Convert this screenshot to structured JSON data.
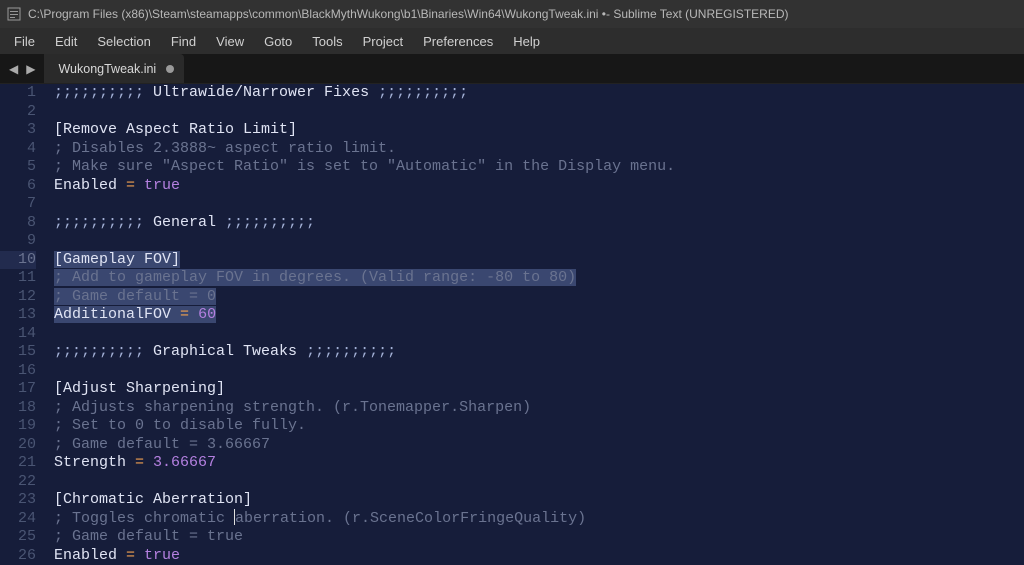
{
  "titlebar": {
    "path": "C:\\Program Files (x86)\\Steam\\steamapps\\common\\BlackMythWukong\\b1\\Binaries\\Win64\\WukongTweak.ini •",
    "app_suffix": " - Sublime Text (UNREGISTERED)"
  },
  "menus": [
    "File",
    "Edit",
    "Selection",
    "Find",
    "View",
    "Goto",
    "Tools",
    "Project",
    "Preferences",
    "Help"
  ],
  "tab": {
    "label": "WukongTweak.ini",
    "dirty": true
  },
  "lines": [
    {
      "n": 1,
      "seg": [
        {
          "c": "tok-punc",
          "t": ";;;;;;;;;; "
        },
        {
          "c": "tok-text",
          "t": "Ultrawide/Narrower Fixes "
        },
        {
          "c": "tok-punc",
          "t": ";;;;;;;;;;"
        }
      ]
    },
    {
      "n": 2,
      "seg": []
    },
    {
      "n": 3,
      "seg": [
        {
          "c": "tok-section",
          "t": "[Remove Aspect Ratio Limit]"
        }
      ]
    },
    {
      "n": 4,
      "seg": [
        {
          "c": "tok-cmt",
          "t": "; Disables 2.3888~ aspect ratio limit."
        }
      ]
    },
    {
      "n": 5,
      "seg": [
        {
          "c": "tok-cmt",
          "t": "; Make sure \"Aspect Ratio\" is set to \"Automatic\" in the Display menu."
        }
      ]
    },
    {
      "n": 6,
      "seg": [
        {
          "c": "tok-key",
          "t": "Enabled "
        },
        {
          "c": "tok-eq",
          "t": "="
        },
        {
          "c": "tok-key",
          "t": " "
        },
        {
          "c": "tok-bool",
          "t": "true"
        }
      ]
    },
    {
      "n": 7,
      "seg": []
    },
    {
      "n": 8,
      "seg": [
        {
          "c": "tok-punc",
          "t": ";;;;;;;;;; "
        },
        {
          "c": "tok-text",
          "t": "General "
        },
        {
          "c": "tok-punc",
          "t": ";;;;;;;;;;"
        }
      ]
    },
    {
      "n": 9,
      "seg": []
    },
    {
      "n": 10,
      "sel": true,
      "seg": [
        {
          "c": "tok-section",
          "t": "[Gameplay FOV]"
        }
      ]
    },
    {
      "n": 11,
      "sel": true,
      "seg": [
        {
          "c": "tok-cmt",
          "t": "; Add to gameplay FOV in degrees. (Valid range: -80 to 80)"
        }
      ]
    },
    {
      "n": 12,
      "sel": true,
      "seg": [
        {
          "c": "tok-cmt",
          "t": "; Game default = 0"
        }
      ]
    },
    {
      "n": 13,
      "sel": true,
      "seg": [
        {
          "c": "tok-key",
          "t": "AdditionalFOV "
        },
        {
          "c": "tok-eq",
          "t": "="
        },
        {
          "c": "tok-key",
          "t": " "
        },
        {
          "c": "tok-num",
          "t": "60"
        }
      ]
    },
    {
      "n": 14,
      "seg": []
    },
    {
      "n": 15,
      "seg": [
        {
          "c": "tok-punc",
          "t": ";;;;;;;;;; "
        },
        {
          "c": "tok-text",
          "t": "Graphical Tweaks "
        },
        {
          "c": "tok-punc",
          "t": ";;;;;;;;;;"
        }
      ]
    },
    {
      "n": 16,
      "seg": []
    },
    {
      "n": 17,
      "seg": [
        {
          "c": "tok-section",
          "t": "[Adjust Sharpening]"
        }
      ]
    },
    {
      "n": 18,
      "seg": [
        {
          "c": "tok-cmt",
          "t": "; Adjusts sharpening strength. (r.Tonemapper.Sharpen)"
        }
      ]
    },
    {
      "n": 19,
      "seg": [
        {
          "c": "tok-cmt",
          "t": "; Set to 0 to disable fully."
        }
      ]
    },
    {
      "n": 20,
      "seg": [
        {
          "c": "tok-cmt",
          "t": "; Game default = 3.66667"
        }
      ]
    },
    {
      "n": 21,
      "seg": [
        {
          "c": "tok-key",
          "t": "Strength "
        },
        {
          "c": "tok-eq",
          "t": "="
        },
        {
          "c": "tok-key",
          "t": " "
        },
        {
          "c": "tok-num",
          "t": "3.66667"
        }
      ]
    },
    {
      "n": 22,
      "seg": []
    },
    {
      "n": 23,
      "seg": [
        {
          "c": "tok-section",
          "t": "[Chromatic Aberration]"
        }
      ]
    },
    {
      "n": 24,
      "cursor_at": 20,
      "seg": [
        {
          "c": "tok-cmt",
          "t": "; Toggles chromatic aberration. (r.SceneColorFringeQuality)"
        }
      ]
    },
    {
      "n": 25,
      "seg": [
        {
          "c": "tok-cmt",
          "t": "; Game default = true"
        }
      ]
    },
    {
      "n": 26,
      "seg": [
        {
          "c": "tok-key",
          "t": "Enabled "
        },
        {
          "c": "tok-eq",
          "t": "="
        },
        {
          "c": "tok-key",
          "t": " "
        },
        {
          "c": "tok-bool",
          "t": "true"
        }
      ]
    }
  ]
}
